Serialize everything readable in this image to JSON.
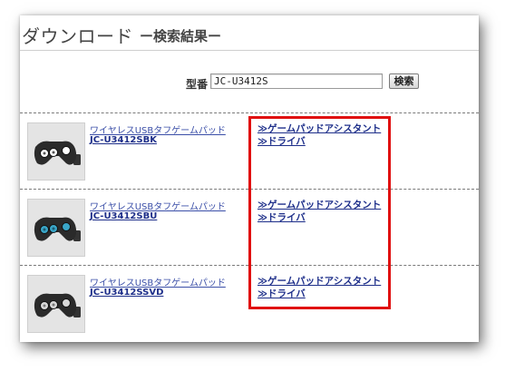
{
  "page": {
    "title": "ダウンロード",
    "subtitle": "ー検索結果ー"
  },
  "search": {
    "label": "型番",
    "value": "JC-U3412S",
    "button_label": "検索"
  },
  "results": [
    {
      "name": "ワイヤレスUSBタフゲームパッド",
      "code": "JC-U3412SBK",
      "links": [
        "≫ゲームパッドアシスタント",
        "≫ドライバ"
      ],
      "color": "#2b2b2b",
      "button_color": "#ffffff"
    },
    {
      "name": "ワイヤレスUSBタフゲームパッド",
      "code": "JC-U3412SBU",
      "links": [
        "≫ゲームパッドアシスタント",
        "≫ドライバ"
      ],
      "color": "#2a2a2a",
      "button_color": "#3aa6c8"
    },
    {
      "name": "ワイヤレスUSBタフゲームパッド",
      "code": "JC-U3412SSVD",
      "links": [
        "≫ゲームパッドアシスタント",
        "≫ドライバ"
      ],
      "color": "#2a2a2a",
      "button_color": "#d8d8d8"
    }
  ],
  "highlight_color": "#e01010"
}
